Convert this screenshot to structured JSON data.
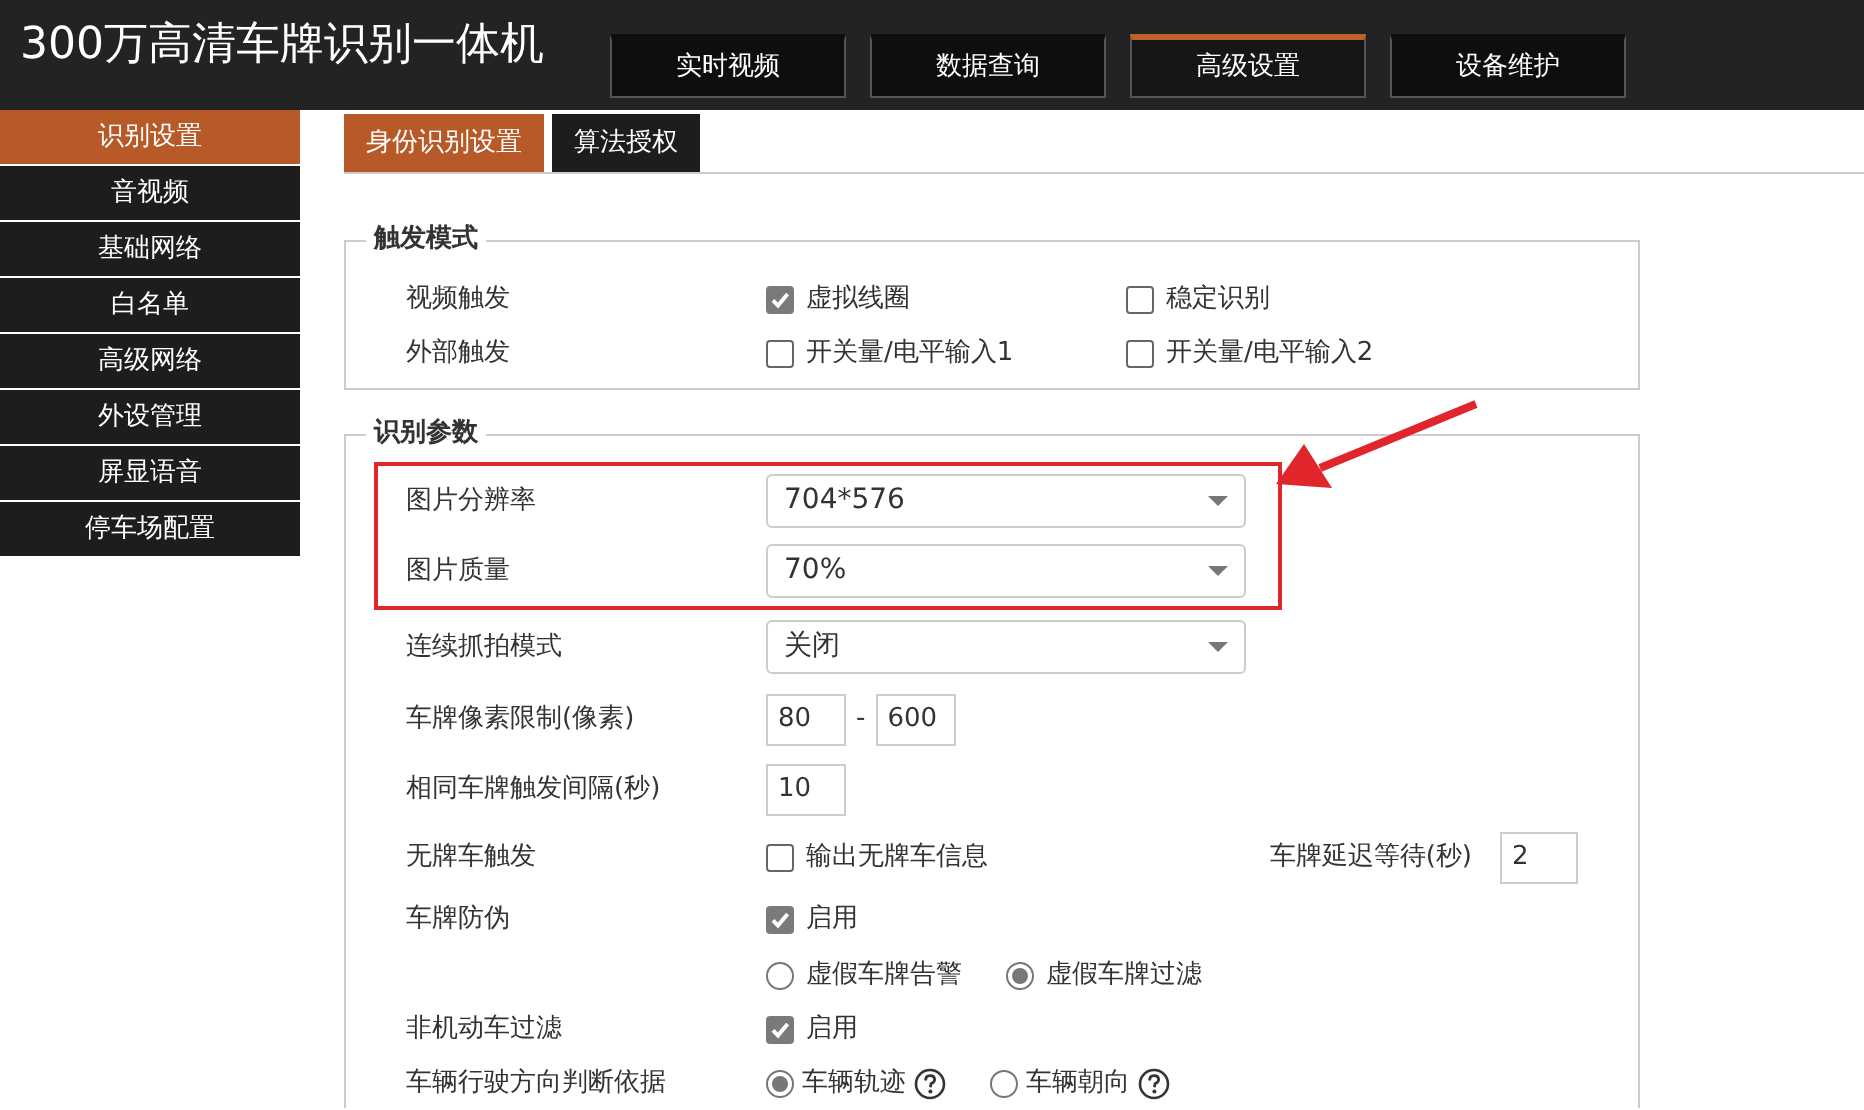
{
  "header": {
    "title": "300万高清车牌识别一体机",
    "nav": [
      {
        "label": "实时视频",
        "selected": false
      },
      {
        "label": "数据查询",
        "selected": false
      },
      {
        "label": "高级设置",
        "selected": true
      },
      {
        "label": "设备维护",
        "selected": false
      }
    ]
  },
  "sidebar": {
    "items": [
      {
        "label": "识别设置",
        "selected": true
      },
      {
        "label": "音视频",
        "selected": false
      },
      {
        "label": "基础网络",
        "selected": false
      },
      {
        "label": "白名单",
        "selected": false
      },
      {
        "label": "高级网络",
        "selected": false
      },
      {
        "label": "外设管理",
        "selected": false
      },
      {
        "label": "屏显语音",
        "selected": false
      },
      {
        "label": "停车场配置",
        "selected": false
      }
    ]
  },
  "subtabs": [
    {
      "label": "身份识别设置",
      "selected": true
    },
    {
      "label": "算法授权",
      "selected": false
    }
  ],
  "trigger_mode": {
    "legend": "触发模式",
    "rows": [
      {
        "label": "视频触发",
        "options": [
          {
            "label": "虚拟线圈",
            "checked": true
          },
          {
            "label": "稳定识别",
            "checked": false
          }
        ]
      },
      {
        "label": "外部触发",
        "options": [
          {
            "label": "开关量/电平输入1",
            "checked": false
          },
          {
            "label": "开关量/电平输入2",
            "checked": false
          }
        ]
      }
    ]
  },
  "recognition": {
    "legend": "识别参数",
    "rows": [
      {
        "kind": "select",
        "label": "图片分辨率",
        "value": "704*576",
        "highlighted": true
      },
      {
        "kind": "select",
        "label": "图片质量",
        "value": "70%",
        "highlighted": true
      },
      {
        "kind": "select",
        "label": "连续抓拍模式",
        "value": "关闭",
        "highlighted": false
      },
      {
        "kind": "range",
        "label": "车牌像素限制(像素)",
        "from": "80",
        "separator": "-",
        "to": "600"
      },
      {
        "kind": "text",
        "label": "相同车牌触发间隔(秒)",
        "value": "10"
      },
      {
        "kind": "checkbox",
        "label": "无牌车触发",
        "option": {
          "label": "输出无牌车信息",
          "checked": false
        },
        "extra": {
          "label": "车牌延迟等待(秒)",
          "value": "2"
        }
      },
      {
        "kind": "checkbox",
        "label": "车牌防伪",
        "option": {
          "label": "启用",
          "checked": true
        }
      },
      {
        "kind": "radio",
        "options": [
          {
            "label": "虚假车牌告警",
            "selected": false
          },
          {
            "label": "虚假车牌过滤",
            "selected": true
          }
        ]
      },
      {
        "kind": "checkbox",
        "label": "非机动车过滤",
        "option": {
          "label": "启用",
          "checked": true
        }
      },
      {
        "kind": "radio",
        "label": "车辆行驶方向判断依据",
        "options": [
          {
            "label": "车辆轨迹",
            "selected": true,
            "help": true
          },
          {
            "label": "车辆朝向",
            "selected": false,
            "help": true
          }
        ]
      }
    ]
  }
}
